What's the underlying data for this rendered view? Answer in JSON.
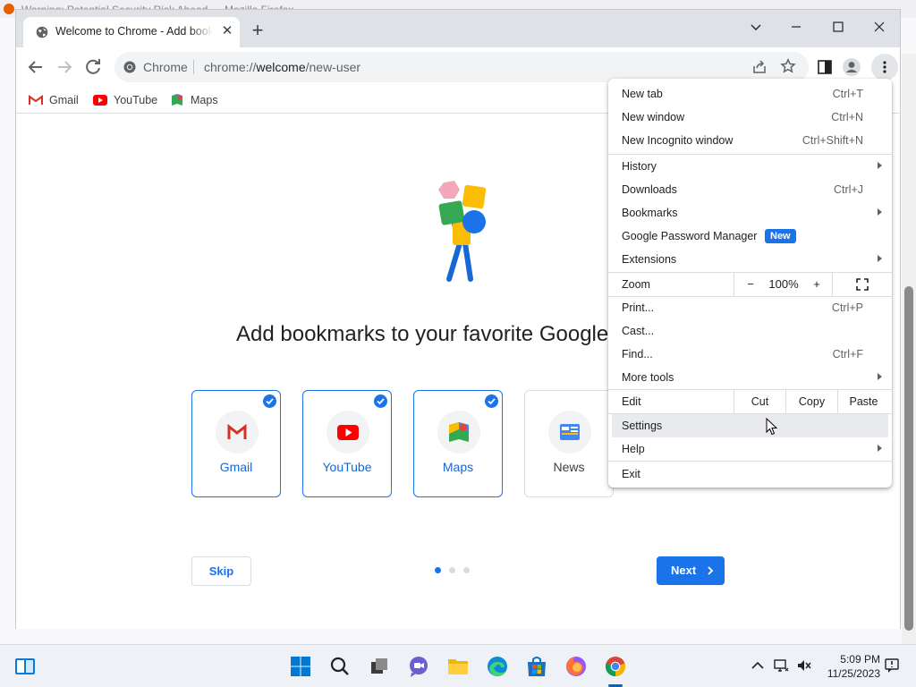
{
  "background_window": {
    "title": "Warning: Potential Security Risk Ahead — Mozilla Firefox"
  },
  "tab": {
    "title": "Welcome to Chrome - Add bookmarks",
    "close_label": "✕",
    "new_tab_label": "+"
  },
  "omnibox": {
    "scheme_label": "Chrome",
    "url_prefix": "chrome://",
    "url_host": "welcome",
    "url_path": "/new-user"
  },
  "bookmarks_bar": [
    {
      "label": "Gmail",
      "icon": "gmail-icon"
    },
    {
      "label": "YouTube",
      "icon": "youtube-icon"
    },
    {
      "label": "Maps",
      "icon": "maps-icon"
    }
  ],
  "page": {
    "headline": "Add bookmarks to your favorite Google apps",
    "cards": [
      {
        "label": "Gmail",
        "selected": true,
        "icon": "gmail-icon"
      },
      {
        "label": "YouTube",
        "selected": true,
        "icon": "youtube-icon"
      },
      {
        "label": "Maps",
        "selected": true,
        "icon": "maps-icon"
      },
      {
        "label": "News",
        "selected": false,
        "icon": "news-icon"
      }
    ],
    "skip_label": "Skip",
    "next_label": "Next",
    "steps": {
      "total": 3,
      "current": 1
    }
  },
  "menu": {
    "new_tab": {
      "label": "New tab",
      "shortcut": "Ctrl+T"
    },
    "new_window": {
      "label": "New window",
      "shortcut": "Ctrl+N"
    },
    "new_incognito": {
      "label": "New Incognito window",
      "shortcut": "Ctrl+Shift+N"
    },
    "history": {
      "label": "History"
    },
    "downloads": {
      "label": "Downloads",
      "shortcut": "Ctrl+J"
    },
    "bookmarks": {
      "label": "Bookmarks"
    },
    "password_manager": {
      "label": "Google Password Manager",
      "badge": "New"
    },
    "extensions": {
      "label": "Extensions"
    },
    "zoom": {
      "label": "Zoom",
      "minus": "−",
      "value": "100%",
      "plus": "+"
    },
    "print": {
      "label": "Print...",
      "shortcut": "Ctrl+P"
    },
    "cast": {
      "label": "Cast..."
    },
    "find": {
      "label": "Find...",
      "shortcut": "Ctrl+F"
    },
    "more_tools": {
      "label": "More tools"
    },
    "edit": {
      "label": "Edit",
      "cut": "Cut",
      "copy": "Copy",
      "paste": "Paste"
    },
    "settings": {
      "label": "Settings",
      "highlighted": true
    },
    "help": {
      "label": "Help"
    },
    "exit": {
      "label": "Exit"
    }
  },
  "taskbar": {
    "apps": [
      "start-icon",
      "search-icon",
      "task-view-icon",
      "teams-chat-icon",
      "file-explorer-icon",
      "edge-icon",
      "store-icon",
      "firefox-icon",
      "chrome-icon"
    ],
    "active_app": "chrome-icon",
    "time": "5:09 PM",
    "date": "11/25/2023"
  },
  "colors": {
    "accent": "#1a73e8",
    "menu_highlight": "#e8eaed",
    "tabbar": "#dee1e6"
  }
}
